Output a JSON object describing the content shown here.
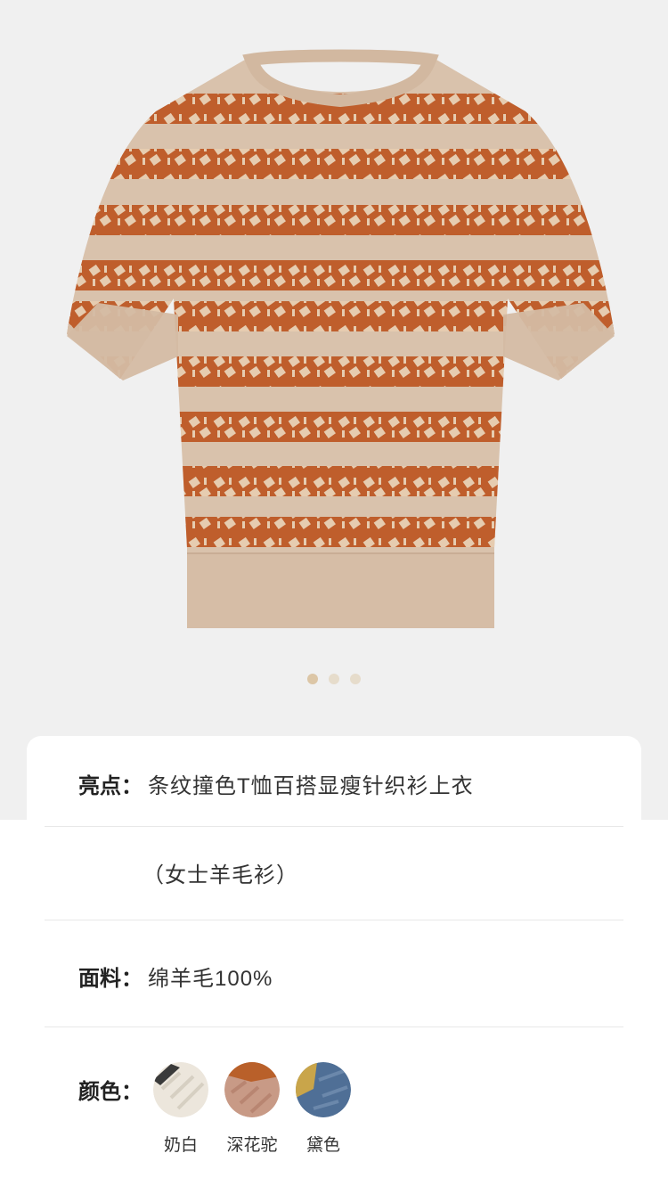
{
  "pagination": {
    "count": 3,
    "active_index": 0
  },
  "details": {
    "highlight_label": "亮点：",
    "highlight_value": "条纹撞色T恤百搭显瘦针织衫上衣",
    "subtitle": "（女士羊毛衫）",
    "fabric_label": "面料：",
    "fabric_value": "绵羊毛100%",
    "color_label": "颜色："
  },
  "colors": [
    {
      "name": "奶白",
      "swatch": "#ece6dc",
      "accent": "#3a3a3a"
    },
    {
      "name": "深花驼",
      "swatch": "#c89a86",
      "accent": "#b9602a"
    },
    {
      "name": "黛色",
      "swatch": "#4f6f96",
      "accent": "#c9a54a"
    }
  ],
  "theme": {
    "stripe_color": "#bf5e2c",
    "knit_base": "#d9c2ac",
    "hero_bg": "#f0f0f0"
  }
}
